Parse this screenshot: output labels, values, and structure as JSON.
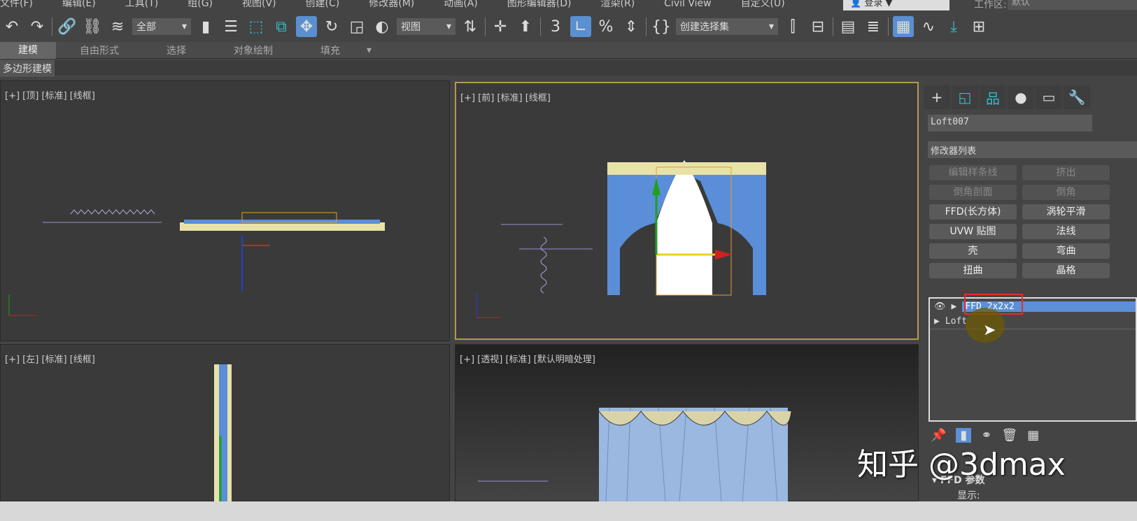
{
  "menu": [
    "文件(F)",
    "编辑(E)",
    "工具(T)",
    "组(G)",
    "视图(V)",
    "创建(C)",
    "修改器(M)",
    "动画(A)",
    "图形编辑器(D)",
    "渲染(R)",
    "Civil View",
    "自定义(U)"
  ],
  "login": "登录",
  "workspace_label": "工作区:",
  "workspace_value": "默认",
  "toolbar": {
    "filter": "全部",
    "ref_coord": "视图",
    "selection_set": "创建选择集"
  },
  "ribbon": {
    "tabs": [
      "建模",
      "自由形式",
      "选择",
      "对象绘制",
      "填充"
    ],
    "active": "建模",
    "sub": "多边形建模"
  },
  "viewports": [
    {
      "label": "[+] [顶] [标准] [线框]"
    },
    {
      "label": "[+] [前] [标准] [线框]"
    },
    {
      "label": "[+] [左] [标准] [线框]"
    },
    {
      "label": "[+] [透视] [标准] [默认明暗处理]"
    }
  ],
  "panel": {
    "object_name": "Loft007",
    "modifier_list": "修改器列表",
    "buttons": [
      [
        "编辑样条线",
        false
      ],
      [
        "挤出",
        false
      ],
      [
        "倒角剖面",
        false
      ],
      [
        "倒角",
        false
      ],
      [
        "FFD(长方体)",
        true
      ],
      [
        "涡轮平滑",
        true
      ],
      [
        "UVW 贴图",
        true
      ],
      [
        "法线",
        true
      ],
      [
        "壳",
        true
      ],
      [
        "弯曲",
        true
      ],
      [
        "扭曲",
        true
      ],
      [
        "晶格",
        true
      ]
    ],
    "stack": [
      "FFD 2x2x2",
      "Loft"
    ],
    "rollout": "FFD 参数",
    "display_label": "显示:"
  },
  "watermark": "知乎 @3dmax",
  "colors": {
    "accent": "#5b8fd6",
    "highlight": "#e03030",
    "viewport_active": "#b59a4a"
  }
}
